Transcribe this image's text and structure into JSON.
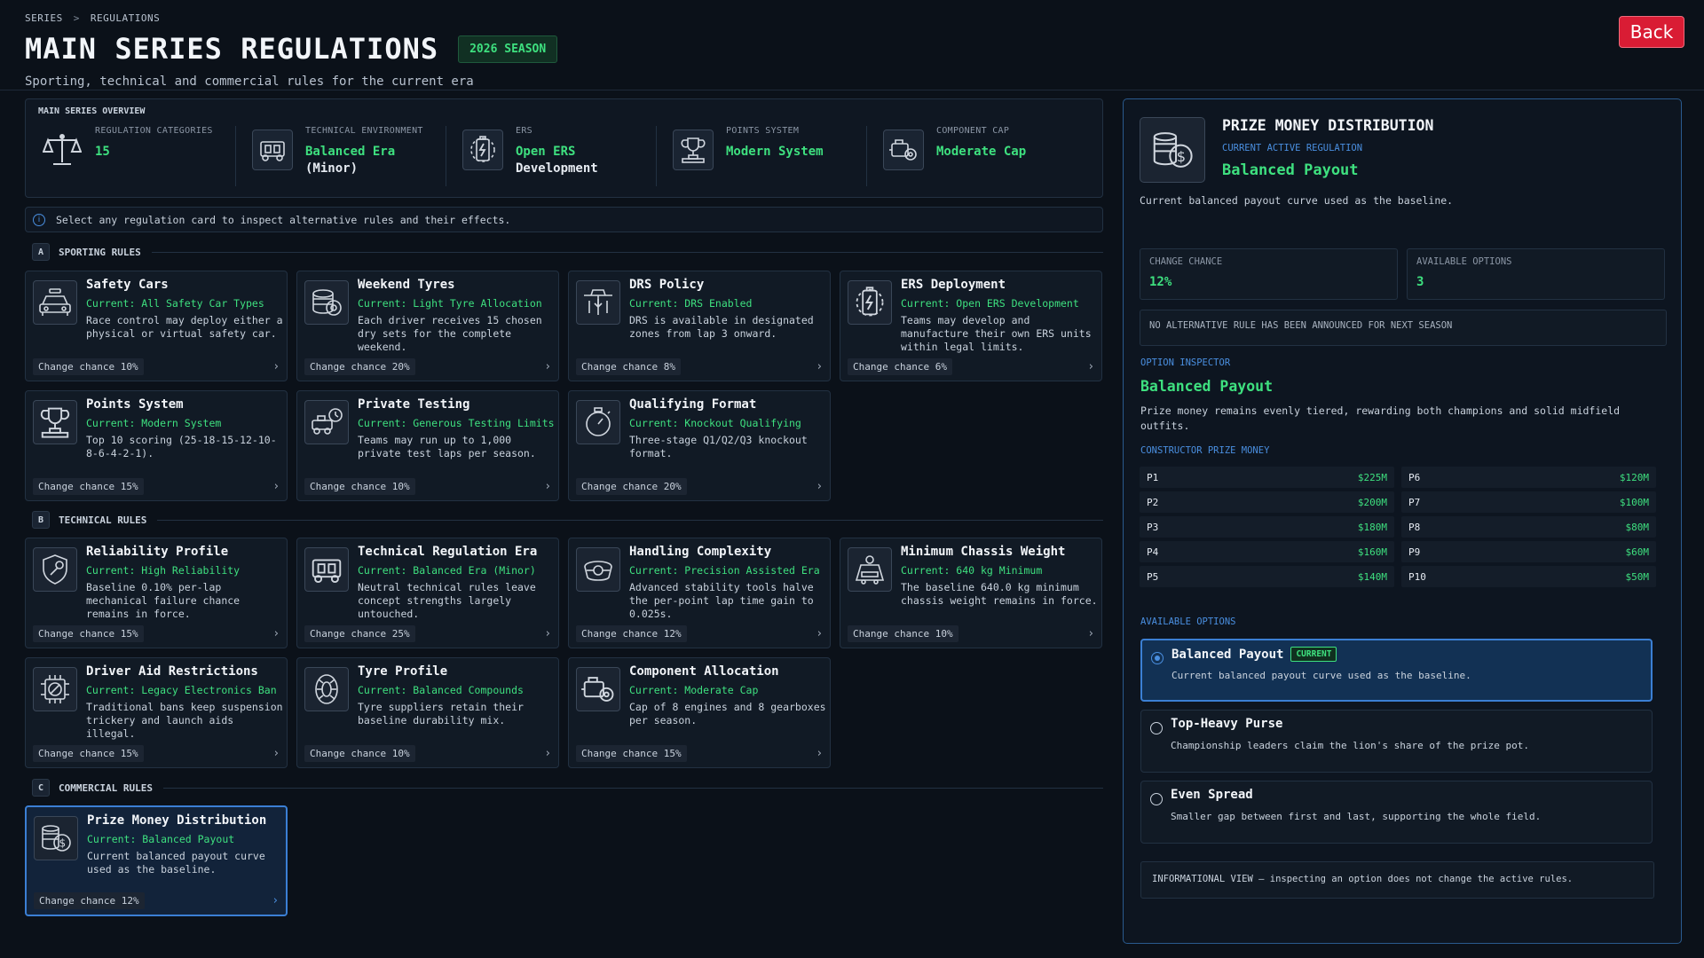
{
  "breadcrumb": {
    "series": "SERIES",
    "separator": ">",
    "current": "REGULATIONS"
  },
  "header": {
    "title": "MAIN SERIES REGULATIONS",
    "season_badge": "2026 SEASON",
    "subtitle": "Sporting, technical and commercial rules for the current era",
    "back_label": "Back"
  },
  "overview": {
    "title": "MAIN SERIES OVERVIEW",
    "items": [
      {
        "icon": "scales-icon",
        "label": "REGULATION CATEGORIES",
        "value": "15"
      },
      {
        "icon": "chassis-icon",
        "label": "TECHNICAL ENVIRONMENT",
        "value": "Balanced Era",
        "value2": "(Minor)"
      },
      {
        "icon": "battery-icon",
        "label": "ERS",
        "value": "Open ERS",
        "value2": "Development"
      },
      {
        "icon": "trophy-icon",
        "label": "POINTS SYSTEM",
        "value": "Modern System"
      },
      {
        "icon": "engine-icon",
        "label": "COMPONENT CAP",
        "value": "Moderate Cap"
      }
    ]
  },
  "info_text": "Select any regulation card to inspect alternative rules and their effects.",
  "sections": {
    "sporting": {
      "letter": "A",
      "title": "SPORTING RULES"
    },
    "technical": {
      "letter": "B",
      "title": "TECHNICAL RULES"
    },
    "commercial": {
      "letter": "C",
      "title": "COMMERCIAL RULES"
    }
  },
  "cards": [
    {
      "icon": "safety-car-icon",
      "title": "Safety Cars",
      "current": "Current: All Safety Car Types",
      "desc": "Race control may deploy either a physical or virtual safety car.",
      "chance": "Change chance 10%"
    },
    {
      "icon": "tyres-icon",
      "title": "Weekend Tyres",
      "current": "Current: Light Tyre Allocation",
      "desc": "Each driver receives 15 chosen dry sets for the complete weekend.",
      "chance": "Change chance 20%"
    },
    {
      "icon": "drs-icon",
      "title": "DRS Policy",
      "current": "Current: DRS Enabled",
      "desc": "DRS is available in designated zones from lap 3 onward.",
      "chance": "Change chance 8%"
    },
    {
      "icon": "battery-icon",
      "title": "ERS Deployment",
      "current": "Current: Open ERS Development",
      "desc": "Teams may develop and manufacture their own ERS units within legal limits.",
      "chance": "Change chance 6%"
    },
    {
      "icon": "trophy-icon",
      "title": "Points System",
      "current": "Current: Modern System",
      "desc": "Top 10 scoring (25-18-15-12-10-8-6-4-2-1).",
      "chance": "Change chance 15%"
    },
    {
      "icon": "testing-icon",
      "title": "Private Testing",
      "current": "Current: Generous Testing Limits",
      "desc": "Teams may run up to 1,000 private test laps per season.",
      "chance": "Change chance 10%"
    },
    {
      "icon": "stopwatch-icon",
      "title": "Qualifying Format",
      "current": "Current: Knockout Qualifying",
      "desc": "Three-stage Q1/Q2/Q3 knockout format.",
      "chance": "Change chance 20%"
    },
    {
      "icon": "shield-wrench-icon",
      "title": "Reliability Profile",
      "current": "Current: High Reliability",
      "desc": "Baseline 0.10% per-lap mechanical failure chance remains in force.",
      "chance": "Change chance 15%"
    },
    {
      "icon": "chassis-icon",
      "title": "Technical Regulation Era",
      "current": "Current: Balanced Era (Minor)",
      "desc": "Neutral technical rules leave concept strengths largely untouched.",
      "chance": "Change chance 25%"
    },
    {
      "icon": "steering-wheel-icon",
      "title": "Handling Complexity",
      "current": "Current: Precision Assisted Era",
      "desc": "Advanced stability tools halve the per-point lap time gain to 0.025s.",
      "chance": "Change chance 12%"
    },
    {
      "icon": "weight-icon",
      "title": "Minimum Chassis Weight",
      "current": "Current: 640 kg Minimum",
      "desc": "The baseline 640.0 kg minimum chassis weight remains in force.",
      "chance": "Change chance 10%"
    },
    {
      "icon": "chip-ban-icon",
      "title": "Driver Aid Restrictions",
      "current": "Current: Legacy Electronics Ban",
      "desc": "Traditional bans keep suspension trickery and launch aids illegal.",
      "chance": "Change chance 15%"
    },
    {
      "icon": "tyre-icon",
      "title": "Tyre Profile",
      "current": "Current: Balanced Compounds",
      "desc": "Tyre suppliers retain their baseline durability mix.",
      "chance": "Change chance 10%"
    },
    {
      "icon": "engine-icon",
      "title": "Component Allocation",
      "current": "Current: Moderate Cap",
      "desc": "Cap of 8 engines and 8 gearboxes per season.",
      "chance": "Change chance 15%"
    },
    {
      "icon": "money-icon",
      "title": "Prize Money Distribution",
      "current": "Current: Balanced Payout",
      "desc": "Current balanced payout curve used as the baseline.",
      "chance": "Change chance 12%"
    }
  ],
  "detail": {
    "title": "PRIZE MONEY DISTRIBUTION",
    "active_label": "CURRENT ACTIVE REGULATION",
    "active_value": "Balanced Payout",
    "description": "Current balanced payout curve used as the baseline.",
    "change_chance_label": "CHANGE CHANCE",
    "change_chance_value": "12%",
    "available_options_label": "AVAILABLE OPTIONS",
    "available_options_value": "3",
    "notice": "NO ALTERNATIVE RULE HAS BEEN ANNOUNCED FOR NEXT SEASON",
    "inspector_label": "OPTION INSPECTOR",
    "inspector_name": "Balanced Payout",
    "inspector_desc": "Prize money remains evenly tiered, rewarding both champions and solid midfield outfits.",
    "prize_label": "CONSTRUCTOR PRIZE MONEY",
    "prizes": [
      {
        "pos": "P1",
        "amount": "$225M"
      },
      {
        "pos": "P6",
        "amount": "$120M"
      },
      {
        "pos": "P2",
        "amount": "$200M"
      },
      {
        "pos": "P7",
        "amount": "$100M"
      },
      {
        "pos": "P3",
        "amount": "$180M"
      },
      {
        "pos": "P8",
        "amount": "$80M"
      },
      {
        "pos": "P4",
        "amount": "$160M"
      },
      {
        "pos": "P9",
        "amount": "$60M"
      },
      {
        "pos": "P5",
        "amount": "$140M"
      },
      {
        "pos": "P10",
        "amount": "$50M"
      }
    ],
    "options_label": "AVAILABLE OPTIONS",
    "current_badge": "CURRENT",
    "options": [
      {
        "title": "Balanced Payout",
        "desc": "Current balanced payout curve used as the baseline."
      },
      {
        "title": "Top-Heavy Purse",
        "desc": "Championship leaders claim the lion's share of the prize pot."
      },
      {
        "title": "Even Spread",
        "desc": "Smaller gap between first and last, supporting the whole field."
      }
    ],
    "footer_note": "INFORMATIONAL VIEW — inspecting an option does not change the active rules."
  }
}
